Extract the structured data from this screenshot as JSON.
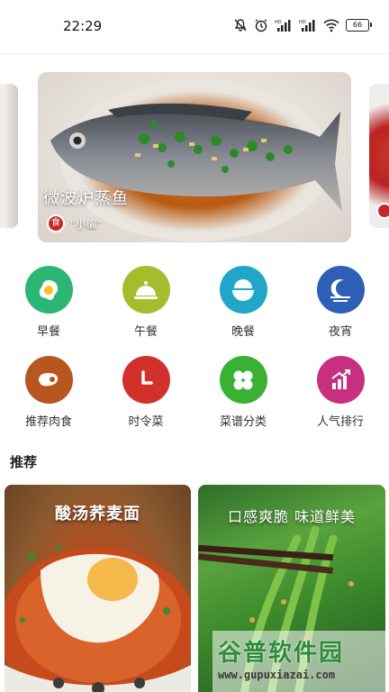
{
  "status_bar": {
    "time": "22:29",
    "icons": [
      "mute-icon",
      "alarm-icon",
      "hd-signal-icon",
      "hd-signal-icon",
      "wifi-icon",
      "battery-icon"
    ],
    "battery": "66"
  },
  "banner": {
    "title": "微波炉蒸鱼",
    "author": "\"小编\"",
    "author_logo": "食"
  },
  "categories": [
    {
      "label": "早餐",
      "icon": "egg-icon",
      "color": "#2bb673"
    },
    {
      "label": "午餐",
      "icon": "cloche-icon",
      "color": "#a4bd2c"
    },
    {
      "label": "晚餐",
      "icon": "bowl-icon",
      "color": "#20a6c8"
    },
    {
      "label": "夜宵",
      "icon": "moon-icon",
      "color": "#2c5fb5"
    },
    {
      "label": "推荐肉食",
      "icon": "meat-icon",
      "color": "#b8561f"
    },
    {
      "label": "时令菜",
      "icon": "clock-icon",
      "color": "#d0312b"
    },
    {
      "label": "菜谱分类",
      "icon": "clover-icon",
      "color": "#39b133"
    },
    {
      "label": "人气排行",
      "icon": "trending-icon",
      "color": "#c8307f"
    }
  ],
  "section": {
    "title": "推荐"
  },
  "recommend": [
    {
      "title": "酸汤荞麦面"
    },
    {
      "title": "口感爽脆 味道鲜美"
    }
  ],
  "watermark": {
    "title": "谷普软件园",
    "url": "www.gupuxiazai.com"
  }
}
